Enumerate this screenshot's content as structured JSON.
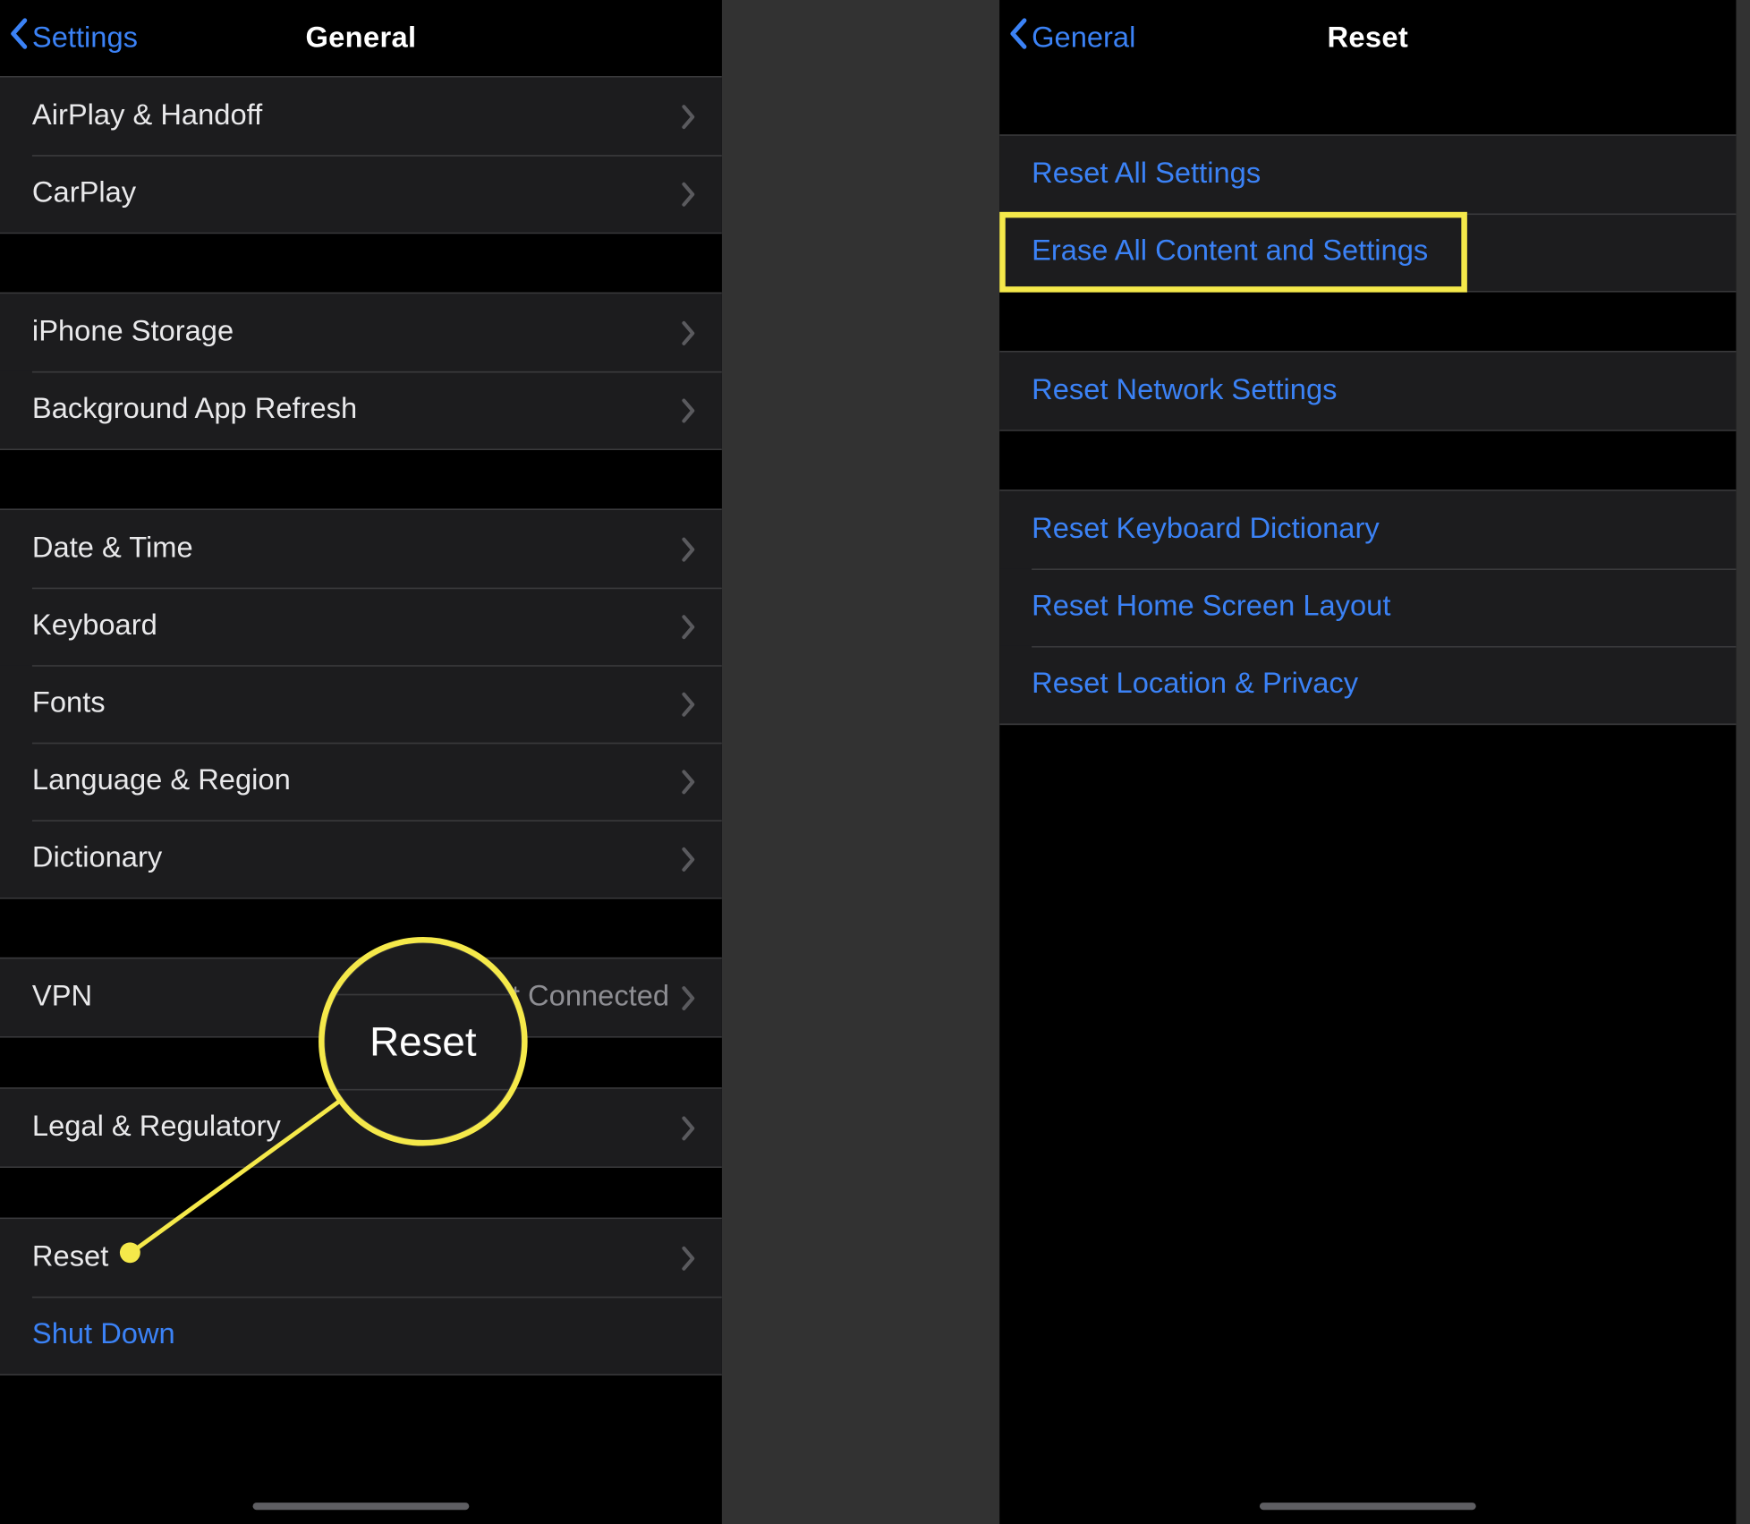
{
  "colors": {
    "link": "#3b82f6",
    "annotation": "#f5e94a",
    "background": "#323232",
    "row_bg": "#1c1c1e",
    "separator": "#3a3a3c",
    "secondary_text": "#8e8e93"
  },
  "left": {
    "back_label": "Settings",
    "title": "General",
    "groups": [
      {
        "rows": [
          {
            "label": "AirPlay & Handoff"
          },
          {
            "label": "CarPlay"
          }
        ]
      },
      {
        "rows": [
          {
            "label": "iPhone Storage"
          },
          {
            "label": "Background App Refresh"
          }
        ]
      },
      {
        "rows": [
          {
            "label": "Date & Time"
          },
          {
            "label": "Keyboard"
          },
          {
            "label": "Fonts"
          },
          {
            "label": "Language & Region"
          },
          {
            "label": "Dictionary"
          }
        ]
      },
      {
        "rows": [
          {
            "label": "VPN",
            "value": "Not Connected"
          }
        ]
      },
      {
        "rows": [
          {
            "label": "Legal & Regulatory"
          }
        ]
      },
      {
        "rows": [
          {
            "label": "Reset"
          },
          {
            "label": "Shut Down",
            "type": "link",
            "no_chevron": true
          }
        ]
      }
    ],
    "callout_label": "Reset"
  },
  "right": {
    "back_label": "General",
    "title": "Reset",
    "groups": [
      {
        "rows": [
          {
            "label": "Reset All Settings",
            "type": "destructive"
          },
          {
            "label": "Erase All Content and Settings",
            "type": "destructive",
            "highlight": true
          }
        ]
      },
      {
        "rows": [
          {
            "label": "Reset Network Settings",
            "type": "destructive"
          }
        ]
      },
      {
        "rows": [
          {
            "label": "Reset Keyboard Dictionary",
            "type": "destructive"
          },
          {
            "label": "Reset Home Screen Layout",
            "type": "destructive"
          },
          {
            "label": "Reset Location & Privacy",
            "type": "destructive"
          }
        ]
      }
    ]
  }
}
